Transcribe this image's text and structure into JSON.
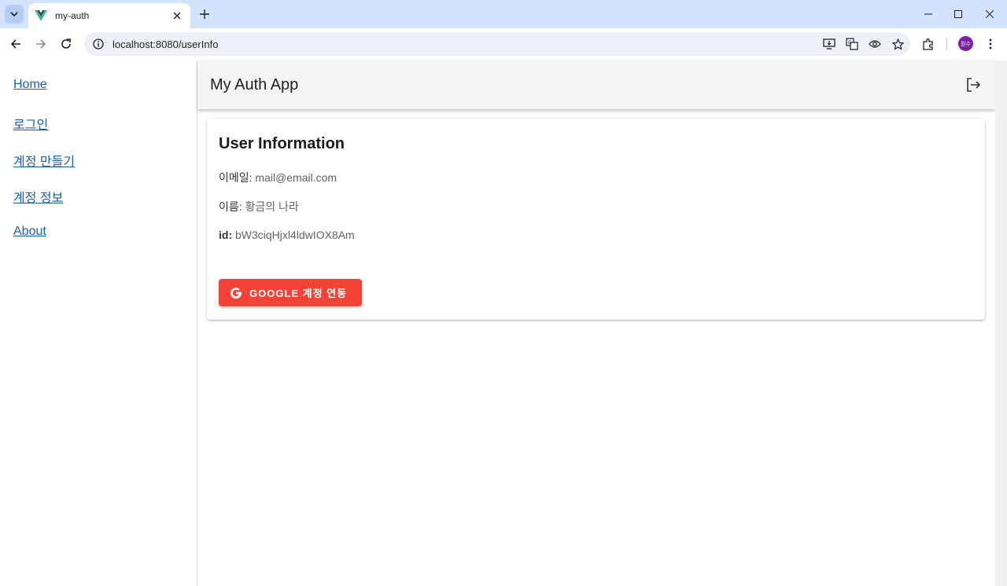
{
  "browser": {
    "tab_title": "my-auth",
    "url": "localhost:8080/userInfo",
    "avatar_text": "원수",
    "icons": [
      "tab-search-icon",
      "vue-favicon-icon",
      "close-icon",
      "plus-icon",
      "minimize-icon",
      "maximize-icon",
      "window-close-icon",
      "back-icon",
      "forward-icon",
      "reload-icon",
      "info-icon",
      "install-icon",
      "translate-icon",
      "eye-icon",
      "star-icon",
      "extensions-icon",
      "menu-icon"
    ]
  },
  "sidebar": {
    "items": [
      {
        "label": "Home"
      },
      {
        "label": "로그인"
      },
      {
        "label": "계정 만들기"
      },
      {
        "label": "계정 정보"
      },
      {
        "label": "About"
      }
    ]
  },
  "appbar": {
    "title": "My Auth App",
    "logout_icon": "logout-icon"
  },
  "card": {
    "title": "User Information",
    "email_label": "이메일:",
    "email_value": "mail@email.com",
    "name_label": "이름:",
    "name_value": "황금의 나라",
    "id_label": "id:",
    "id_value": "bW3ciqHjxl4ldwIOX8Am",
    "google_button_label": "GOOGLE 계정 연동",
    "google_icon": "google-icon"
  },
  "colors": {
    "chrome": "#d3e3fd",
    "appbar": "#f5f5f5",
    "google_button": "#f44336",
    "link": "#1a5fb4"
  }
}
